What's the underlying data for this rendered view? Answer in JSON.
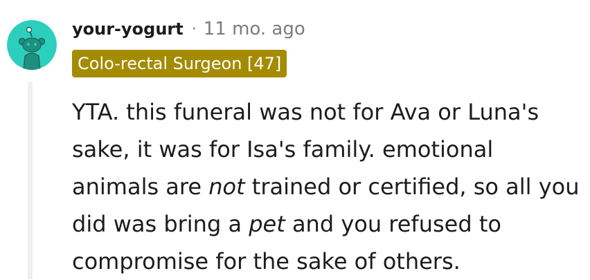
{
  "comment": {
    "author": "your-yogurt",
    "separator": "·",
    "timestamp": "11 mo. ago",
    "flair": "Colo-rectal Surgeon [47]",
    "body": {
      "part1": "YTA. this funeral was not for Ava or Luna's sake, it was for Isa's family. emotional animals are ",
      "emphasis1": "not",
      "part2": " trained or certified, so all you did was bring a ",
      "emphasis2": "pet",
      "part3": " and you refused to compromise for the sake of others."
    }
  },
  "colors": {
    "avatar_bg": "#2ccfbe",
    "flair_bg": "#a48b00",
    "text": "#1c1c1c",
    "meta": "#7c7c7c",
    "thread_line": "#edeff1"
  },
  "icons": {
    "avatar": "snoo-avatar-icon"
  }
}
